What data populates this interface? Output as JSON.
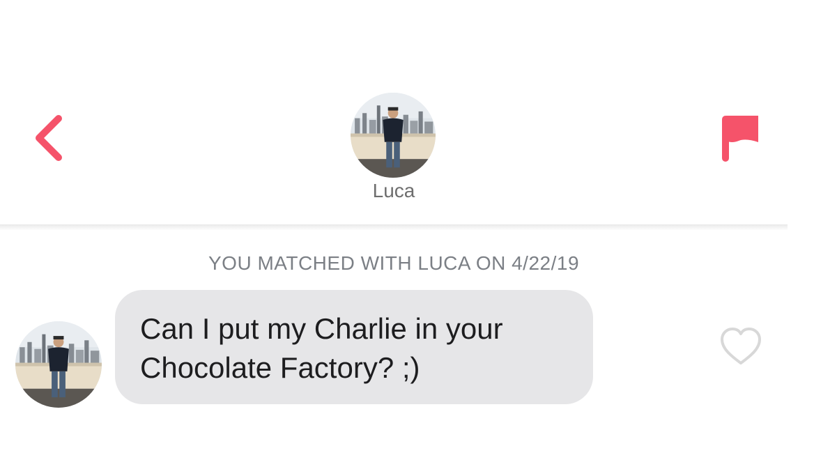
{
  "header": {
    "match_name": "Luca",
    "back_icon": "chevron-left-icon",
    "flag_icon": "flag-icon",
    "accent_color": "#f5536a"
  },
  "conversation": {
    "match_note": "YOU MATCHED WITH LUCA ON 4/22/19",
    "messages": [
      {
        "sender": "Luca",
        "lines": [
          "Can I put my Charlie in your",
          "Chocolate Factory? ;)"
        ],
        "like_icon": "heart-outline-icon"
      }
    ]
  }
}
